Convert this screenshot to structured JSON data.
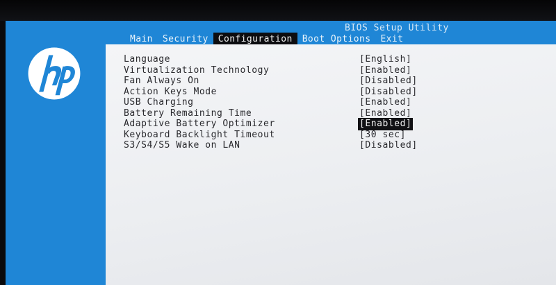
{
  "header": {
    "title": "BIOS Setup Utility"
  },
  "menu": {
    "items": [
      {
        "label": "Main"
      },
      {
        "label": "Security"
      },
      {
        "label": "Configuration"
      },
      {
        "label": "Boot Options"
      },
      {
        "label": "Exit"
      }
    ],
    "active_index": 2
  },
  "logo": {
    "icon": "hp-logo-icon",
    "color": "#ffffff"
  },
  "settings": [
    {
      "label": "Language",
      "value": "[English]"
    },
    {
      "label": "Virtualization Technology",
      "value": "[Enabled]"
    },
    {
      "label": "Fan Always On",
      "value": "[Disabled]"
    },
    {
      "label": "Action Keys Mode",
      "value": "[Disabled]"
    },
    {
      "label": "USB Charging",
      "value": "[Enabled]"
    },
    {
      "label": "Battery Remaining Time",
      "value": "[Enabled]"
    },
    {
      "label": "Adaptive Battery Optimizer",
      "value": "[Enabled]"
    },
    {
      "label": "Keyboard Backlight Timeout",
      "value": "[30 sec]"
    },
    {
      "label": "S3/S4/S5 Wake on LAN",
      "value": "[Disabled]"
    }
  ],
  "selected_setting_index": 6,
  "colors": {
    "bios_blue": "#1f86d6",
    "panel": "#eceef1",
    "highlight": "#111114"
  }
}
